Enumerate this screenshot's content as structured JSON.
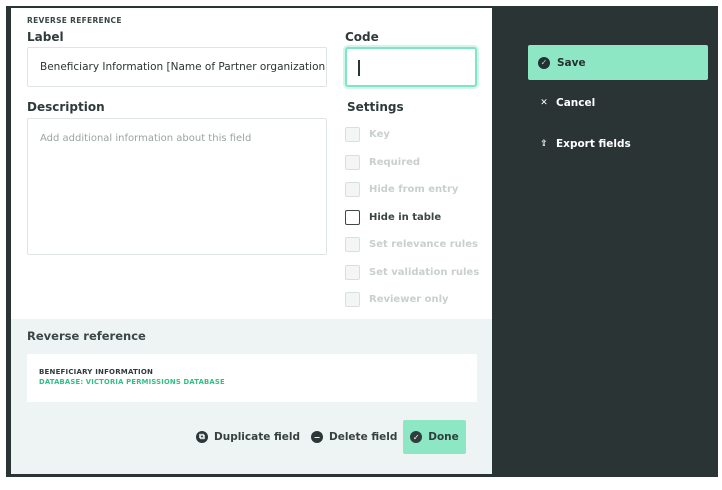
{
  "panel": {
    "kicker": "REVERSE REFERENCE",
    "label_heading": "Label",
    "label_value": "Beneficiary Information [Name of Partner organization]",
    "code_heading": "Code",
    "code_value": "",
    "description_heading": "Description",
    "description_placeholder": "Add additional information about this field",
    "settings_heading": "Settings",
    "settings": [
      {
        "label": "Key",
        "active": false
      },
      {
        "label": "Required",
        "active": false
      },
      {
        "label": "Hide from entry",
        "active": false
      },
      {
        "label": "Hide in table",
        "active": true
      },
      {
        "label": "Set relevance rules",
        "active": false
      },
      {
        "label": "Set validation rules",
        "active": false
      },
      {
        "label": "Reviewer only",
        "active": false
      }
    ],
    "reverse_reference": {
      "title": "Reverse reference",
      "form_name": "BENEFICIARY INFORMATION",
      "database": "DATABASE: VICTORIA PERMISSIONS DATABASE"
    },
    "actions": {
      "duplicate_label": "Duplicate field",
      "delete_label": "Delete field",
      "done_label": "Done"
    }
  },
  "sidebar": {
    "save_label": "Save",
    "cancel_label": "Cancel",
    "export_label": "Export fields"
  },
  "colors": {
    "accent": "#8ee7c4",
    "dark": "#2a3435",
    "database_text": "#2fbf86"
  }
}
